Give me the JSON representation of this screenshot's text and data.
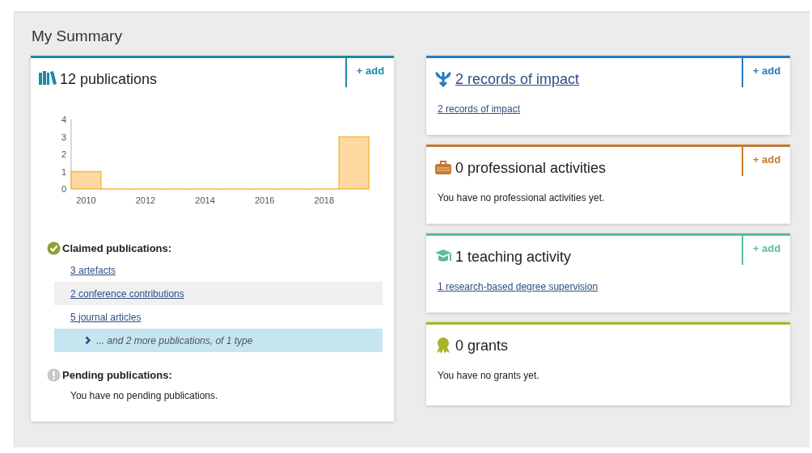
{
  "title": "My Summary",
  "publications": {
    "title": "12 publications",
    "color": "#1b8aa6",
    "add": "+ add",
    "chart_data": {
      "type": "bar",
      "x": [
        2010,
        2011,
        2012,
        2013,
        2014,
        2015,
        2016,
        2017,
        2018,
        2019
      ],
      "values": [
        1,
        0,
        0,
        0,
        0,
        0,
        0,
        0,
        0,
        3
      ],
      "xticks": [
        2010,
        2012,
        2014,
        2016,
        2018
      ],
      "xlim": [
        2009.5,
        2019.5
      ],
      "yticks": [
        0,
        1,
        2,
        3,
        4
      ],
      "ylim": [
        0,
        4
      ]
    },
    "claimed": {
      "heading": "Claimed publications:",
      "items": [
        {
          "label": "3 artefacts",
          "kind": "link"
        },
        {
          "label": "2 conference contributions",
          "kind": "link"
        },
        {
          "label": "5 journal articles",
          "kind": "link"
        },
        {
          "label": "... and 2 more publications, of 1 type",
          "kind": "more"
        }
      ]
    },
    "pending": {
      "heading": "Pending publications:",
      "message": "You have no pending publications."
    }
  },
  "cards": [
    {
      "kind": "impact",
      "title": "2 records of impact",
      "title_link": true,
      "color": "#2a78c2",
      "add": "+ add",
      "links": [
        "2 records of impact"
      ]
    },
    {
      "kind": "briefcase",
      "title": "0 professional activities",
      "title_link": false,
      "color": "#c57a30",
      "add": "+ add",
      "message": "You have no professional activities yet."
    },
    {
      "kind": "teaching",
      "title": "1 teaching activity",
      "title_link": false,
      "color": "#5bbb9c",
      "add": "+ add",
      "links": [
        "1 research-based degree supervision"
      ]
    },
    {
      "kind": "award",
      "title": "0 grants",
      "title_link": false,
      "color": "#a6b42a",
      "message": "You have no grants yet."
    }
  ]
}
